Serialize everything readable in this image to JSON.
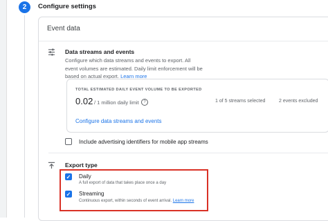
{
  "step": {
    "number": "2",
    "title": "Configure settings"
  },
  "panel": {
    "title": "Event data"
  },
  "data_streams": {
    "icon": "tune-icon",
    "title": "Data streams and events",
    "description": "Configure which data streams and events to export. All event volumes are estimated. Daily limit enforcement will be based on actual export.",
    "learn_more": "Learn more"
  },
  "volume_card": {
    "label": "TOTAL ESTIMATED DAILY EVENT VOLUME TO BE EXPORTED",
    "value": "0.02",
    "limit": "/ 1 million daily limit",
    "help_icon": "?",
    "streams_selected": "1 of 5 streams selected",
    "events_excluded": "2 events excluded",
    "configure_link": "Configure data streams and events"
  },
  "advertising": {
    "label": "Include advertising identifiers for mobile app streams",
    "checked": false
  },
  "export_type": {
    "icon": "upload-icon",
    "title": "Export type",
    "options": [
      {
        "title": "Daily",
        "description": "A full export of data that takes place once a day",
        "checked": true
      },
      {
        "title": "Streaming",
        "description": "Continuous export, within seconds of event arrival.",
        "learn_more": "Learn more",
        "checked": true
      }
    ]
  },
  "colors": {
    "accent": "#1a73e8",
    "highlight_border": "#d93025"
  }
}
